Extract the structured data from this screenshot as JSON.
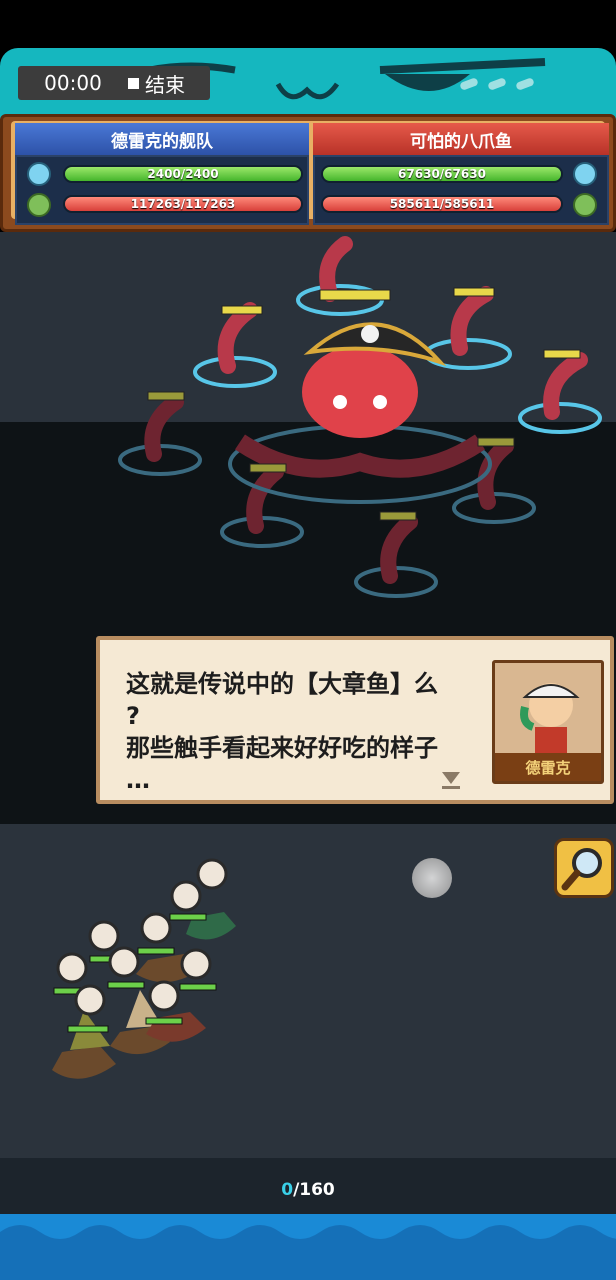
{
  "recorder": {
    "time": "00:00",
    "stop_label": "结束"
  },
  "teams": {
    "player": {
      "name": "德雷克的舰队",
      "hp": "2400/2400",
      "power": "117263/117263"
    },
    "enemy": {
      "name": "可怕的八爪鱼",
      "hp": "67630/67630",
      "power": "585611/585611"
    }
  },
  "dialog": {
    "text": "这就是传说中的【大章鱼】么\n?\n那些触手看起来好好吃的样子\n…",
    "speaker": "德雷克"
  },
  "progress": {
    "current": "0",
    "total": "/160"
  },
  "colors": {
    "banner": "#15b7bf",
    "player_header": "#3a66c4",
    "enemy_header": "#d8463a",
    "hp_bar": "#6cd04a",
    "power_bar": "#e65a4e",
    "sea": "#2b333c",
    "progress_current": "#3ad0e8"
  }
}
